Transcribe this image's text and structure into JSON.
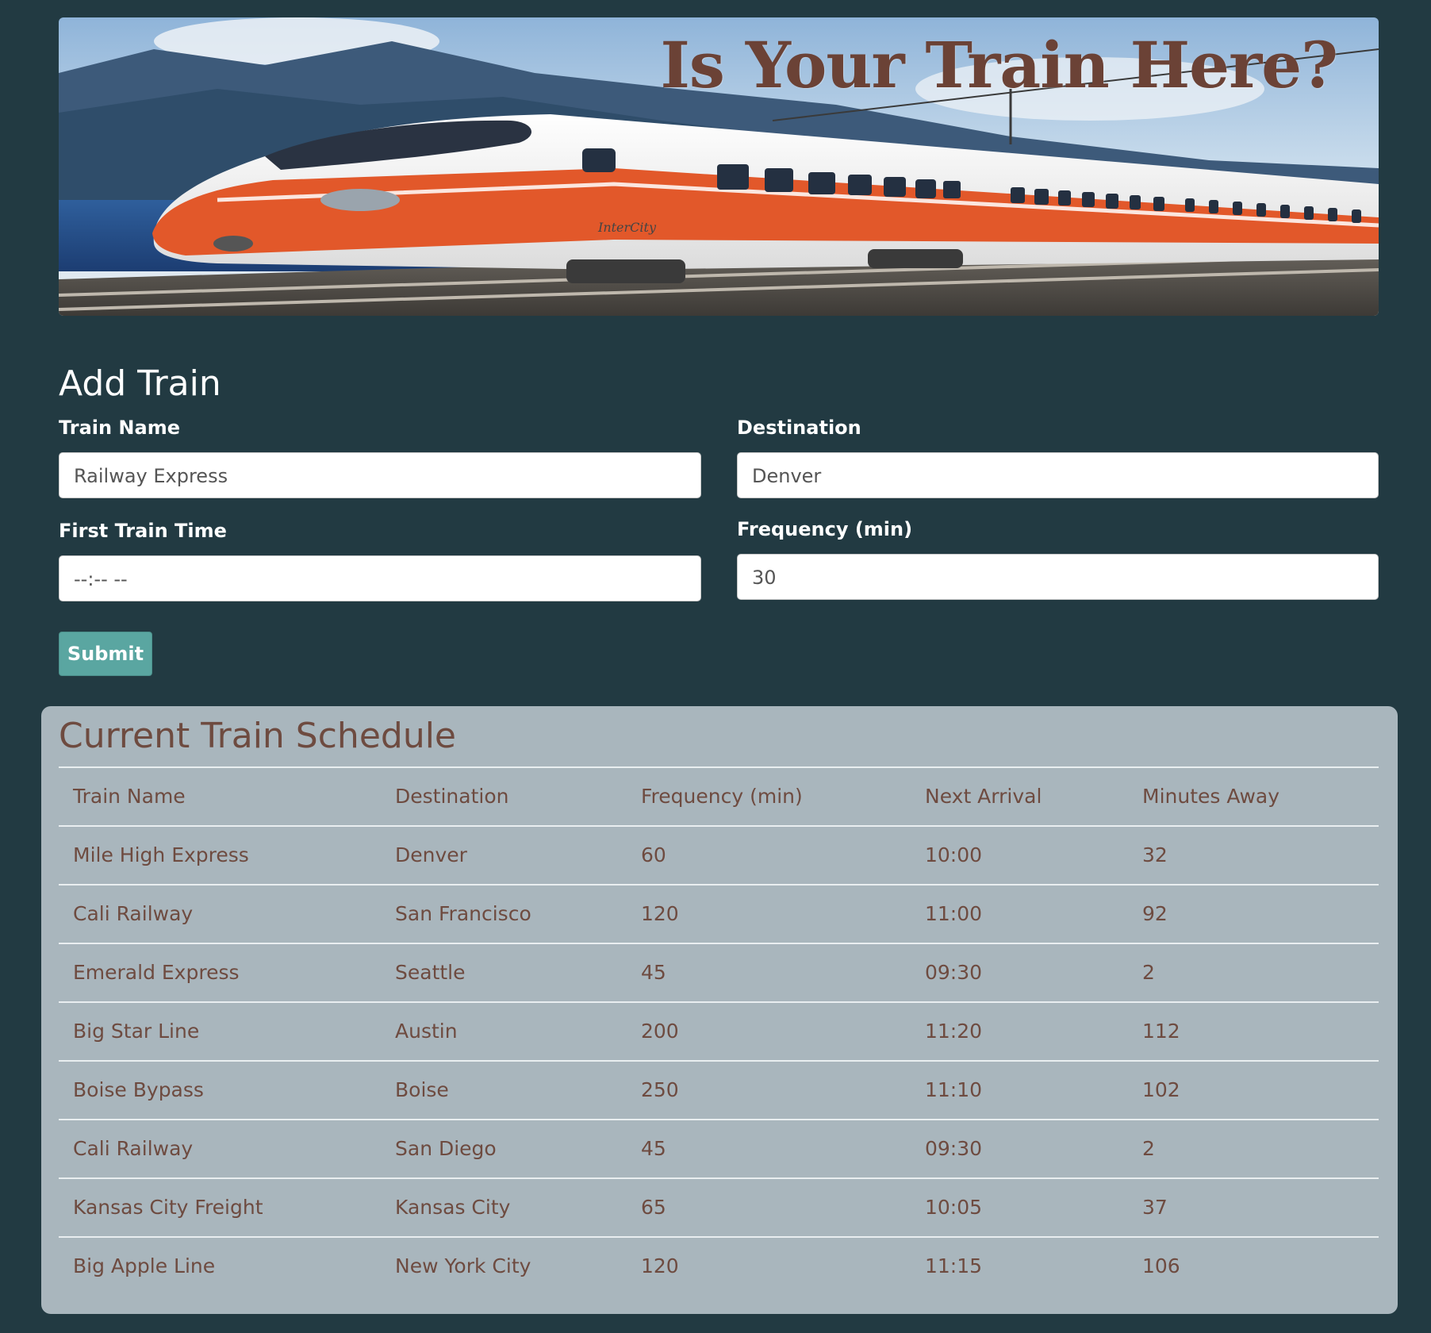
{
  "banner": {
    "title": "Is Your Train Here?",
    "train_logo_text": "InterCity"
  },
  "form": {
    "title": "Add Train",
    "fields": {
      "train_name": {
        "label": "Train Name",
        "value": "Railway Express"
      },
      "destination": {
        "label": "Destination",
        "value": "Denver"
      },
      "first_train_time": {
        "label": "First Train Time",
        "value": "--:-- --"
      },
      "frequency": {
        "label": "Frequency (min)",
        "value": "30"
      }
    },
    "submit_label": "Submit"
  },
  "schedule": {
    "title": "Current Train Schedule",
    "columns": [
      "Train Name",
      "Destination",
      "Frequency (min)",
      "Next Arrival",
      "Minutes Away"
    ],
    "rows": [
      [
        "Mile High Express",
        "Denver",
        "60",
        "10:00",
        "32"
      ],
      [
        "Cali Railway",
        "San Francisco",
        "120",
        "11:00",
        "92"
      ],
      [
        "Emerald Express",
        "Seattle",
        "45",
        "09:30",
        "2"
      ],
      [
        "Big Star Line",
        "Austin",
        "200",
        "11:20",
        "112"
      ],
      [
        "Boise Bypass",
        "Boise",
        "250",
        "11:10",
        "102"
      ],
      [
        "Cali Railway",
        "San Diego",
        "45",
        "09:30",
        "2"
      ],
      [
        "Kansas City Freight",
        "Kansas City",
        "65",
        "10:05",
        "37"
      ],
      [
        "Big Apple Line",
        "New York City",
        "120",
        "11:15",
        "106"
      ]
    ]
  },
  "colors": {
    "page_background": "#223a42",
    "panel_background": "#a9b6bd",
    "panel_text": "#6e4b40",
    "submit_button": "#5aa6a1",
    "banner_title": "#6b4236"
  }
}
